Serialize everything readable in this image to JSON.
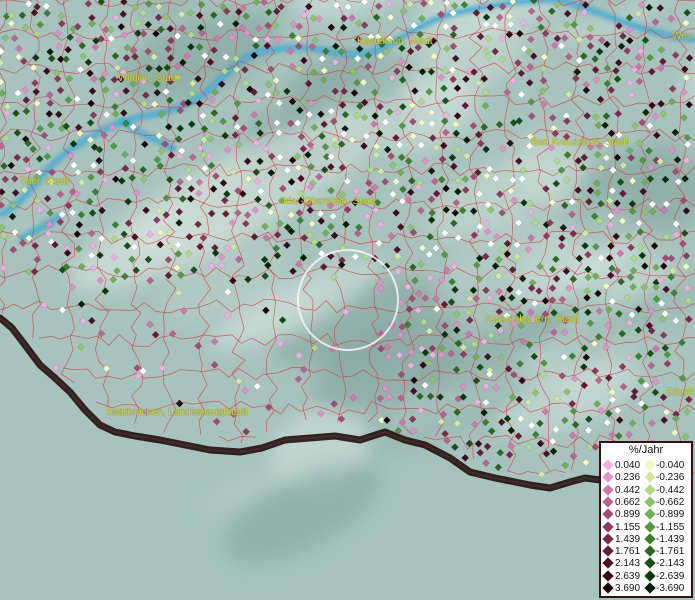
{
  "cities": [
    {
      "id": "kastellaun",
      "name": "Kastellaun, Stadt"
    },
    {
      "id": "wittlich",
      "name": "Wittlich, Stadt"
    },
    {
      "id": "trier",
      "name": "Trier, Stadt"
    },
    {
      "id": "idar",
      "name": "Idar-Oberstein, Stadt"
    },
    {
      "id": "badkreuznach",
      "name": "Bad Kreuznach, Stadt"
    },
    {
      "id": "kaiserslautern",
      "name": "Kaiserslautern, Stadt"
    },
    {
      "id": "saarbruecken",
      "name": "Saarbrücken, Landeshauptstadt"
    },
    {
      "id": "wes",
      "name": "Wes"
    },
    {
      "id": "edenk",
      "name": "Edenk"
    }
  ],
  "legend": {
    "title": "%/Jahr",
    "positive": [
      {
        "label": "0.040",
        "color": "#f2aee0"
      },
      {
        "label": "0.236",
        "color": "#e58fc8"
      },
      {
        "label": "0.442",
        "color": "#d276ad"
      },
      {
        "label": "0.662",
        "color": "#c06090"
      },
      {
        "label": "0.899",
        "color": "#a94a74"
      },
      {
        "label": "1.155",
        "color": "#94385e"
      },
      {
        "label": "1.439",
        "color": "#7c2848"
      },
      {
        "label": "1.761",
        "color": "#661a36"
      },
      {
        "label": "2.143",
        "color": "#4e0f24"
      },
      {
        "label": "2.639",
        "color": "#3a0816"
      },
      {
        "label": "3.690",
        "color": "#22020a"
      }
    ],
    "negative": [
      {
        "label": "-0.040",
        "color": "#f0fac4"
      },
      {
        "label": "-0.236",
        "color": "#cfeaa0"
      },
      {
        "label": "-0.442",
        "color": "#aedb86"
      },
      {
        "label": "-0.662",
        "color": "#8cc66a"
      },
      {
        "label": "-0.899",
        "color": "#6eb054"
      },
      {
        "label": "-1.155",
        "color": "#529a40"
      },
      {
        "label": "-1.439",
        "color": "#3b822e"
      },
      {
        "label": "-1.761",
        "color": "#276a20"
      },
      {
        "label": "-2.143",
        "color": "#175214"
      },
      {
        "label": "-2.639",
        "color": "#0b3a0a"
      },
      {
        "label": "-3.690",
        "color": "#032205"
      }
    ]
  },
  "colors": {
    "terrain": "#a6c6c0",
    "river": "#2e9ed0",
    "borders": "#e0303a",
    "state_border": "#1a0a0a",
    "no_data": "#ffffff"
  }
}
